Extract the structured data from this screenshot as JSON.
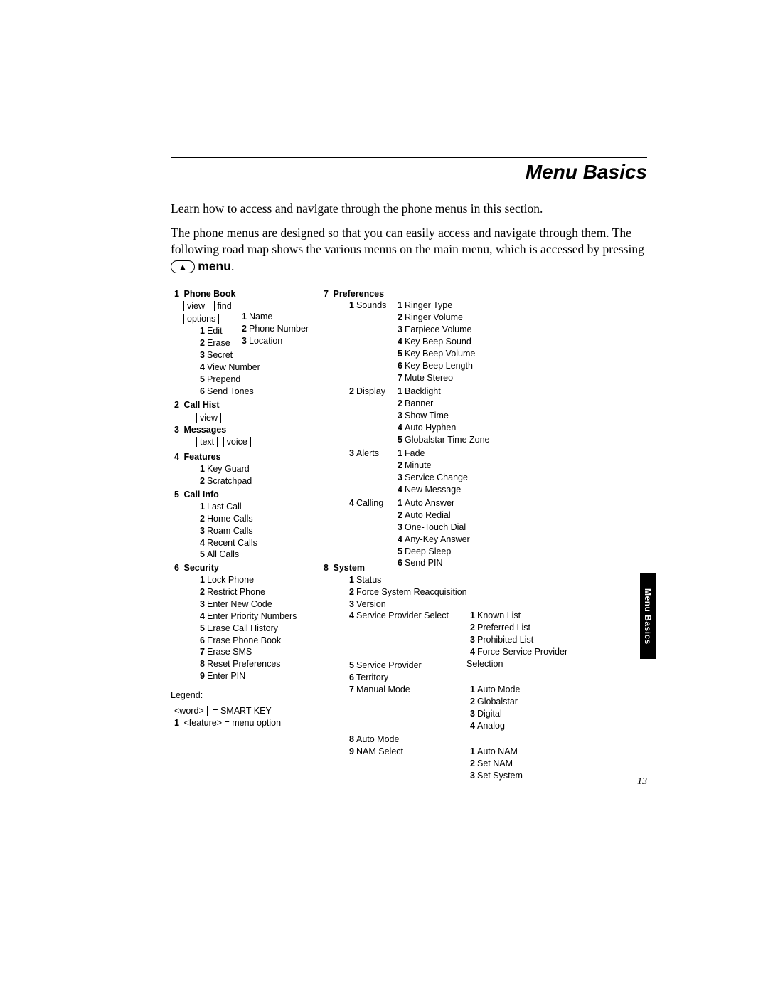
{
  "title": "Menu Basics",
  "intro1": "Learn how to access and navigate through the phone menus in this section.",
  "intro2a": "The phone menus are designed so that you can easily access and navigate through them. The following road map shows the various menus on the main menu, which is accessed by pressing ",
  "intro2_btn": "▲",
  "intro2_menu": " menu",
  "intro2_end": ".",
  "side_tab": "Menu Basics",
  "page_number": "13",
  "legend": {
    "title": "Legend:",
    "smart_sample": "<word>",
    "smart_eq": " =  SMART KEY",
    "feat_num": "1",
    "feat_sample": "<feature> =  menu option"
  },
  "menu": {
    "m1": {
      "n": "1",
      "t": "Phone Book",
      "sk": [
        "view",
        "find",
        "options"
      ],
      "find_sub": [
        {
          "n": "1",
          "t": "Name"
        },
        {
          "n": "2",
          "t": "Phone Number"
        },
        {
          "n": "3",
          "t": "Location"
        }
      ],
      "opt_sub": [
        {
          "n": "1",
          "t": "Edit"
        },
        {
          "n": "2",
          "t": "Erase"
        },
        {
          "n": "3",
          "t": "Secret"
        },
        {
          "n": "4",
          "t": "View Number"
        },
        {
          "n": "5",
          "t": "Prepend"
        },
        {
          "n": "6",
          "t": "Send Tones"
        }
      ]
    },
    "m2": {
      "n": "2",
      "t": "Call Hist",
      "sk": [
        "view"
      ]
    },
    "m3": {
      "n": "3",
      "t": "Messages",
      "sk": [
        "text",
        "voice"
      ]
    },
    "m4": {
      "n": "4",
      "t": "Features",
      "sub": [
        {
          "n": "1",
          "t": "Key Guard"
        },
        {
          "n": "2",
          "t": "Scratchpad"
        }
      ]
    },
    "m5": {
      "n": "5",
      "t": "Call Info",
      "sub": [
        {
          "n": "1",
          "t": "Last Call"
        },
        {
          "n": "2",
          "t": "Home Calls"
        },
        {
          "n": "3",
          "t": "Roam Calls"
        },
        {
          "n": "4",
          "t": "Recent Calls"
        },
        {
          "n": "5",
          "t": "All Calls"
        }
      ]
    },
    "m6": {
      "n": "6",
      "t": "Security",
      "sub": [
        {
          "n": "1",
          "t": "Lock Phone"
        },
        {
          "n": "2",
          "t": "Restrict Phone"
        },
        {
          "n": "3",
          "t": "Enter New Code"
        },
        {
          "n": "4",
          "t": "Enter Priority Numbers"
        },
        {
          "n": "5",
          "t": "Erase Call History"
        },
        {
          "n": "6",
          "t": "Erase Phone Book"
        },
        {
          "n": "7",
          "t": "Erase SMS"
        },
        {
          "n": "8",
          "t": "Reset Preferences"
        },
        {
          "n": "9",
          "t": "Enter PIN"
        }
      ]
    },
    "m7": {
      "n": "7",
      "t": "Preferences",
      "sub": [
        {
          "n": "1",
          "t": "Sounds",
          "sub": [
            {
              "n": "1",
              "t": "Ringer Type"
            },
            {
              "n": "2",
              "t": "Ringer Volume"
            },
            {
              "n": "3",
              "t": "Earpiece Volume"
            },
            {
              "n": "4",
              "t": "Key Beep Sound"
            },
            {
              "n": "5",
              "t": "Key Beep Volume"
            },
            {
              "n": "6",
              "t": "Key Beep Length"
            },
            {
              "n": "7",
              "t": "Mute Stereo"
            }
          ]
        },
        {
          "n": "2",
          "t": "Display",
          "sub": [
            {
              "n": "1",
              "t": "Backlight"
            },
            {
              "n": "2",
              "t": "Banner"
            },
            {
              "n": "3",
              "t": "Show Time"
            },
            {
              "n": "4",
              "t": "Auto Hyphen"
            },
            {
              "n": "5",
              "t": "Globalstar Time Zone"
            }
          ]
        },
        {
          "n": "3",
          "t": "Alerts",
          "sub": [
            {
              "n": "1",
              "t": "Fade"
            },
            {
              "n": "2",
              "t": "Minute"
            },
            {
              "n": "3",
              "t": "Service Change"
            },
            {
              "n": "4",
              "t": "New Message"
            }
          ]
        },
        {
          "n": "4",
          "t": "Calling",
          "sub": [
            {
              "n": "1",
              "t": "Auto Answer"
            },
            {
              "n": "2",
              "t": "Auto Redial"
            },
            {
              "n": "3",
              "t": "One-Touch Dial"
            },
            {
              "n": "4",
              "t": "Any-Key Answer"
            },
            {
              "n": "5",
              "t": "Deep Sleep"
            },
            {
              "n": "6",
              "t": "Send PIN"
            }
          ]
        }
      ]
    },
    "m8": {
      "n": "8",
      "t": "System",
      "sub": [
        {
          "n": "1",
          "t": "Status"
        },
        {
          "n": "2",
          "t": "Force System Reacquisition"
        },
        {
          "n": "3",
          "t": "Version"
        },
        {
          "n": "4",
          "t": "Service Provider Select",
          "sub": [
            {
              "n": "1",
              "t": "Known List"
            },
            {
              "n": "2",
              "t": "Preferred List"
            },
            {
              "n": "3",
              "t": "Prohibited List"
            },
            {
              "n": "4",
              "t": "Force Service Provider Selection"
            }
          ]
        },
        {
          "n": "5",
          "t": "Service Provider"
        },
        {
          "n": "6",
          "t": "Territory"
        },
        {
          "n": "7",
          "t": "Manual Mode",
          "sub": [
            {
              "n": "1",
              "t": "Auto Mode"
            },
            {
              "n": "2",
              "t": "Globalstar"
            },
            {
              "n": "3",
              "t": "Digital"
            },
            {
              "n": "4",
              "t": "Analog"
            }
          ]
        },
        {
          "n": "8",
          "t": "Auto Mode"
        },
        {
          "n": "9",
          "t": "NAM Select",
          "sub": [
            {
              "n": "1",
              "t": "Auto NAM"
            },
            {
              "n": "2",
              "t": "Set NAM"
            },
            {
              "n": "3",
              "t": "Set System"
            }
          ]
        }
      ]
    }
  }
}
